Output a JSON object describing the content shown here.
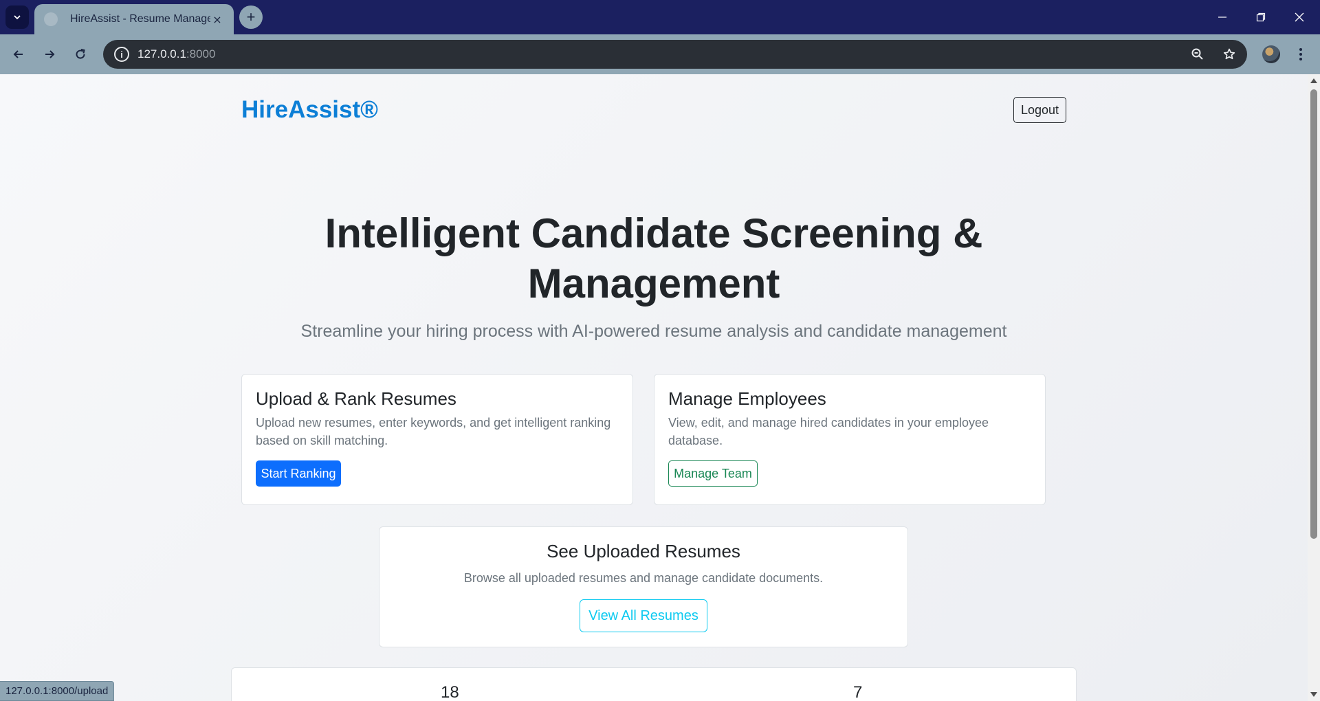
{
  "browser": {
    "tab_title": "HireAssist - Resume Manager",
    "tab_close_glyph": "×",
    "new_tab_glyph": "+",
    "url_host": "127.0.0.1",
    "url_port": ":8000",
    "status_url": "127.0.0.1:8000/upload"
  },
  "header": {
    "brand": "HireAssist®",
    "logout_label": "Logout"
  },
  "hero": {
    "title": "Intelligent Candidate Screening & Management",
    "subtitle": "Streamline your hiring process with AI-powered resume analysis and candidate management"
  },
  "cards": {
    "upload": {
      "title": "Upload & Rank Resumes",
      "text": "Upload new resumes, enter keywords, and get intelligent ranking based on skill matching.",
      "button": "Start Ranking"
    },
    "employees": {
      "title": "Manage Employees",
      "text": "View, edit, and manage hired candidates in your employee database.",
      "button": "Manage Team"
    },
    "resumes": {
      "title": "See Uploaded Resumes",
      "text": "Browse all uploaded resumes and manage candidate documents.",
      "button": "View All Resumes"
    }
  },
  "stats": {
    "first_value": "18",
    "second_value": "7"
  },
  "colors": {
    "brand": "#0d7fd6",
    "primary": "#0d6efd",
    "success": "#198754",
    "info": "#0dcaf0"
  },
  "icons": [
    "tab-search-icon",
    "back-arrow-icon",
    "forward-arrow-icon",
    "reload-icon",
    "site-info-icon",
    "zoom-out-icon",
    "bookmark-star-icon",
    "minimize-icon",
    "restore-icon",
    "close-window-icon",
    "kebab-menu-icon"
  ]
}
